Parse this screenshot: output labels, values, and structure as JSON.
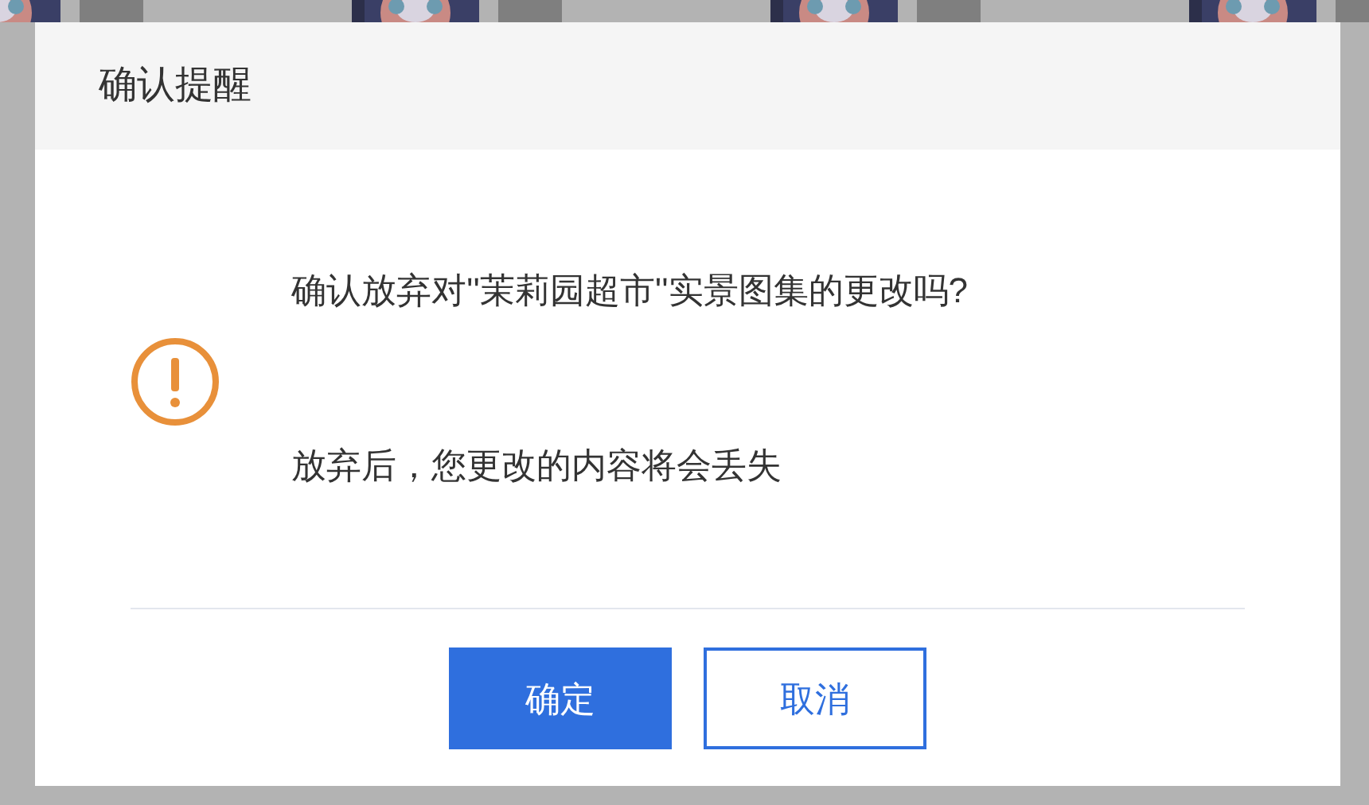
{
  "dialog": {
    "title": "确认提醒",
    "message": "确认放弃对''茉莉园超市''实景图集的更改吗?",
    "detail": "放弃后，您更改的内容将会丢失",
    "buttons": [
      {
        "label": "确定",
        "kind": "primary"
      },
      {
        "label": "取消",
        "kind": "secondary"
      }
    ]
  }
}
